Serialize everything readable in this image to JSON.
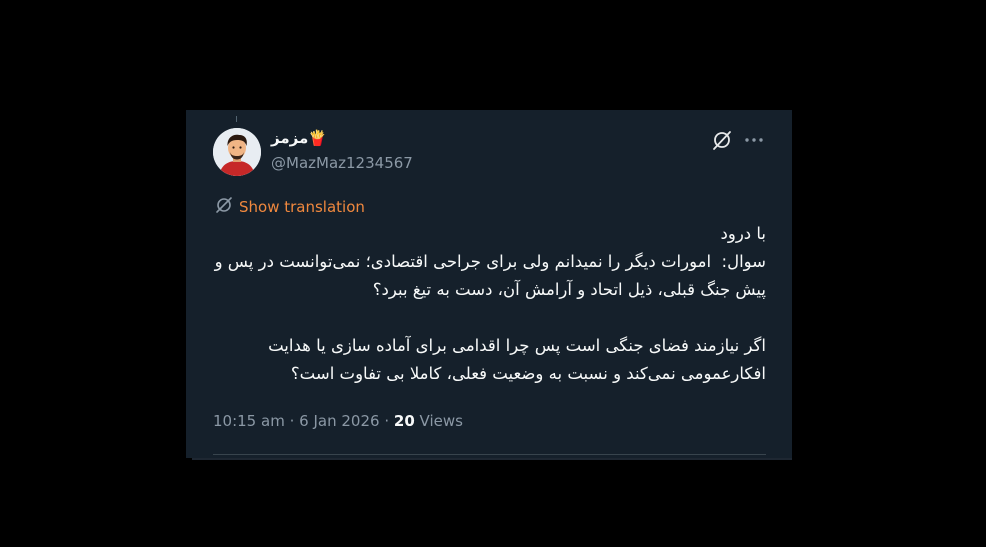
{
  "author": {
    "display_name": "مزمز🍟",
    "handle": "@MazMaz1234567",
    "avatar_icon": "person-avatar-icon"
  },
  "actions": {
    "grok_icon": "grok-icon",
    "more_icon": "more-horizontal-icon"
  },
  "translation": {
    "label": "Show translation",
    "color": "#f0883e"
  },
  "tweet": {
    "text": "با درود\nسوال:  امورات دیگر را نمیدانم ولی برای جراحی اقتصادی؛ نمی‌توانست در پس و پیش جنگ قبلی، ذیل اتحاد و آرامش آن، دست به تیغ ببرد؟\n\nاگر نیازمند فضای جنگی است پس چرا اقدامی برای آماده سازی یا هدایت افکارعمومی نمی‌کند و نسبت به وضعیت فعلی، کاملا بی تفاوت است؟"
  },
  "meta": {
    "time": "10:15 am",
    "separator": "·",
    "date": "6 Jan 2026",
    "views_count": "20",
    "views_label": "Views"
  },
  "colors": {
    "background": "#15202b",
    "text": "#f7f9f9",
    "muted": "#8b98a5"
  }
}
